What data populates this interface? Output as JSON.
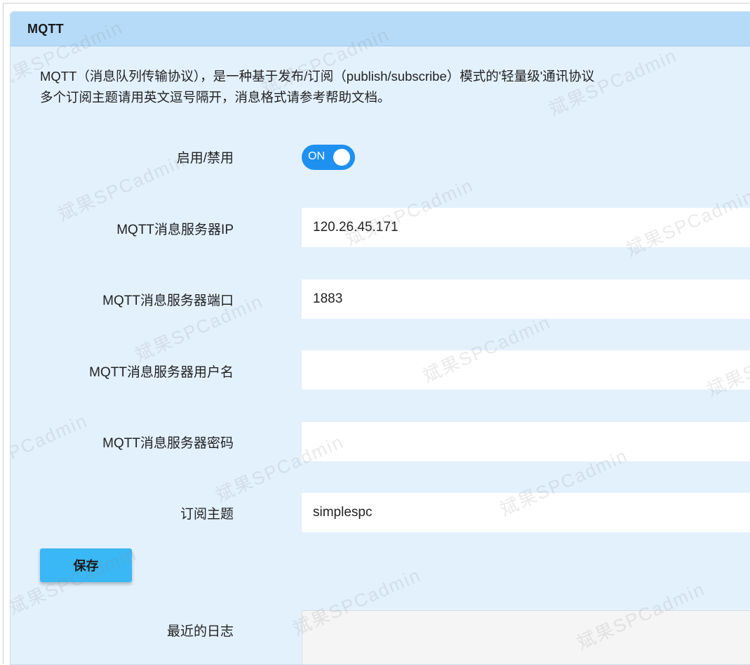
{
  "panel": {
    "title": "MQTT",
    "desc_line1": "MQTT（消息队列传输协议），是一种基于发布/订阅（publish/subscribe）模式的'轻量级'通讯协议",
    "desc_line2": "多个订阅主题请用英文逗号隔开，消息格式请参考帮助文档。"
  },
  "form": {
    "enable_label": "启用/禁用",
    "toggle_text": "ON",
    "toggle_on": true,
    "server_ip_label": "MQTT消息服务器IP",
    "server_ip_value": "120.26.45.171",
    "server_port_label": "MQTT消息服务器端口",
    "server_port_value": "1883",
    "username_label": "MQTT消息服务器用户名",
    "username_value": "",
    "password_label": "MQTT消息服务器密码",
    "password_value": "",
    "topic_label": "订阅主题",
    "topic_value": "simplespc",
    "save_label": "保存",
    "log_label": "最近的日志"
  },
  "watermark": {
    "text": "斌果SPCadmin"
  },
  "colors": {
    "panel_bg": "#e3f1fd",
    "header_bg": "#b5dbf8",
    "toggle_on": "#1e90f0",
    "save_button": "#3ab7f5"
  }
}
